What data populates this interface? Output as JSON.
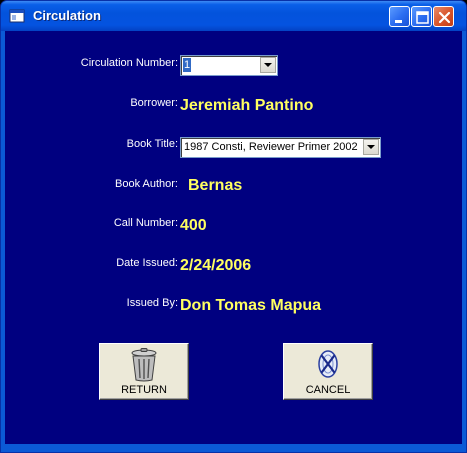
{
  "window": {
    "title": "Circulation",
    "icon": "app-window-icon"
  },
  "form": {
    "circulation_number_label": "Circulation Number:",
    "circulation_number_value": "1",
    "borrower_label": "Borrower:",
    "borrower_value": "Jeremiah Pantino",
    "book_title_label": "Book Title:",
    "book_title_value": "1987 Consti, Reviewer Primer  2002",
    "book_author_label": "Book Author:",
    "book_author_value": "Bernas",
    "call_number_label": "Call Number:",
    "call_number_value": "400",
    "date_issued_label": "Date Issued:",
    "date_issued_value": "2/24/2006",
    "issued_by_label": "Issued By:",
    "issued_by_value": "Don Tomas Mapua"
  },
  "buttons": {
    "return_label": "RETURN",
    "return_icon": "trash-can-icon",
    "cancel_label": "CANCEL",
    "cancel_icon": "cancel-x-icon"
  },
  "colors": {
    "form_background": "#000080",
    "label_text": "#ffffff",
    "value_text": "#ffff60",
    "titlebar": "#0353dc"
  }
}
